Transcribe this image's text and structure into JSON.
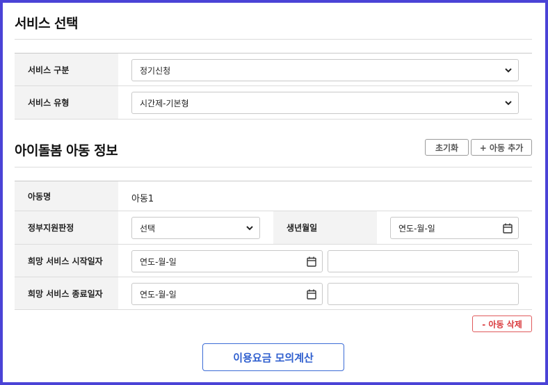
{
  "service_section": {
    "title": "서비스 선택",
    "rows": [
      {
        "label": "서비스 구분",
        "value": "정기신청"
      },
      {
        "label": "서비스 유형",
        "value": "시간제-기본형"
      }
    ]
  },
  "child_section": {
    "title": "아이돌봄 아동 정보",
    "reset_label": "초기화",
    "add_child_label": "+ 아동 추가",
    "child_name_label": "아동명",
    "child_name_value": "아동1",
    "gov_support_label": "정부지원판정",
    "gov_support_value": "선택",
    "birth_label": "생년월일",
    "birth_placeholder": "연도-월-일",
    "start_label": "희망 서비스 시작일자",
    "start_placeholder": "연도-월-일",
    "end_label": "희망 서비스 종료일자",
    "end_placeholder": "연도-월-일",
    "delete_child_label": "- 아동 삭제"
  },
  "calculate_label": "이용요금 모의계산",
  "colors": {
    "border_frame": "#4a43d6",
    "primary": "#2f5fcf",
    "danger": "#d9383b",
    "header_bg": "#f3f3f3"
  },
  "icons": {
    "select": "chevron-down-icon",
    "date": "calendar-icon"
  }
}
